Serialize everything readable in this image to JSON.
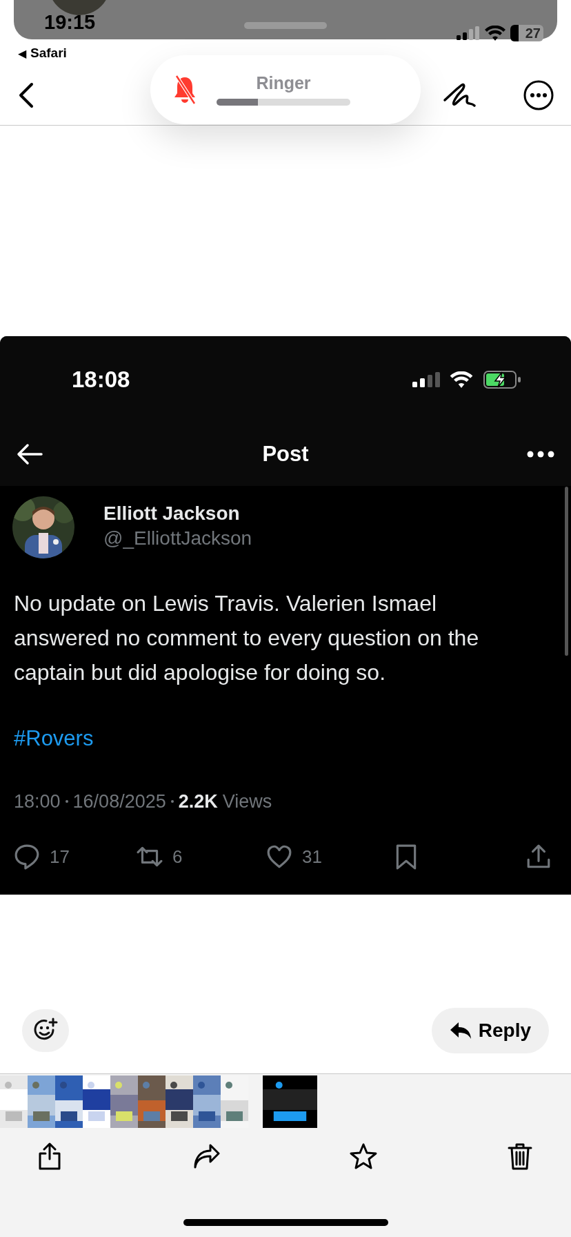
{
  "notification_banner": {
    "time": "19:15"
  },
  "status_bar": {
    "battery": "27"
  },
  "back_to_app": {
    "arrow": "◀",
    "label": "Safari"
  },
  "ringer": {
    "label": "Ringer",
    "muted": true,
    "level": 0.31
  },
  "post_screenshot": {
    "status_time": "18:08",
    "title": "Post",
    "author": {
      "name": "Elliott Jackson",
      "handle": "@_ElliottJackson"
    },
    "text": "No update on Lewis Travis. Valerien Ismael answered no comment to every question on the captain but did apologise for doing so.",
    "hashtag": "#Rovers",
    "meta": {
      "time": "18:00",
      "date": "16/08/2025",
      "views_count": "2.2K",
      "views_label": "Views"
    },
    "actions": [
      {
        "kind": "reply",
        "count": "17"
      },
      {
        "kind": "repost",
        "count": "6"
      },
      {
        "kind": "like",
        "count": "31"
      },
      {
        "kind": "bookmark"
      },
      {
        "kind": "share"
      }
    ]
  },
  "reply_button": {
    "label": "Reply"
  },
  "thumbnails": [
    {
      "kind": "picture",
      "selected": false
    },
    {
      "kind": "picture",
      "selected": false
    },
    {
      "kind": "picture",
      "selected": false
    },
    {
      "kind": "picture",
      "selected": false
    },
    {
      "kind": "picture",
      "selected": false
    },
    {
      "kind": "picture",
      "selected": false
    },
    {
      "kind": "picture",
      "selected": false
    },
    {
      "kind": "picture",
      "selected": false
    },
    {
      "kind": "picture",
      "selected": false
    },
    {
      "kind": "picture",
      "selected": true
    }
  ],
  "toolbar": [
    {
      "kind": "share"
    },
    {
      "kind": "forward"
    },
    {
      "kind": "favorite"
    },
    {
      "kind": "delete"
    }
  ]
}
